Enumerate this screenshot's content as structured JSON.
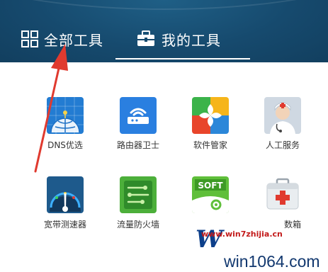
{
  "tabs": {
    "all_label": "全部工具",
    "mine_label": "我的工具"
  },
  "tools": [
    {
      "label": "DNS优选",
      "icon": "dns-globe-icon"
    },
    {
      "label": "路由器卫士",
      "icon": "router-icon"
    },
    {
      "label": "软件管家",
      "icon": "software-manager-icon"
    },
    {
      "label": "人工服务",
      "icon": "doctor-icon"
    },
    {
      "label": "宽带测速器",
      "icon": "speedometer-icon"
    },
    {
      "label": "流量防火墙",
      "icon": "traffic-firewall-icon"
    },
    {
      "label": "SOFT",
      "icon": "soft-icon"
    },
    {
      "label": "数箱",
      "icon": "first-aid-kit-icon"
    }
  ],
  "watermark": {
    "win": "W",
    "site_small": "www.win7zhijia.cn",
    "site": "win1064.com"
  },
  "colors": {
    "header_bg": "#164a6e",
    "arrow": "#e03a2f",
    "label_text": "#333333"
  }
}
